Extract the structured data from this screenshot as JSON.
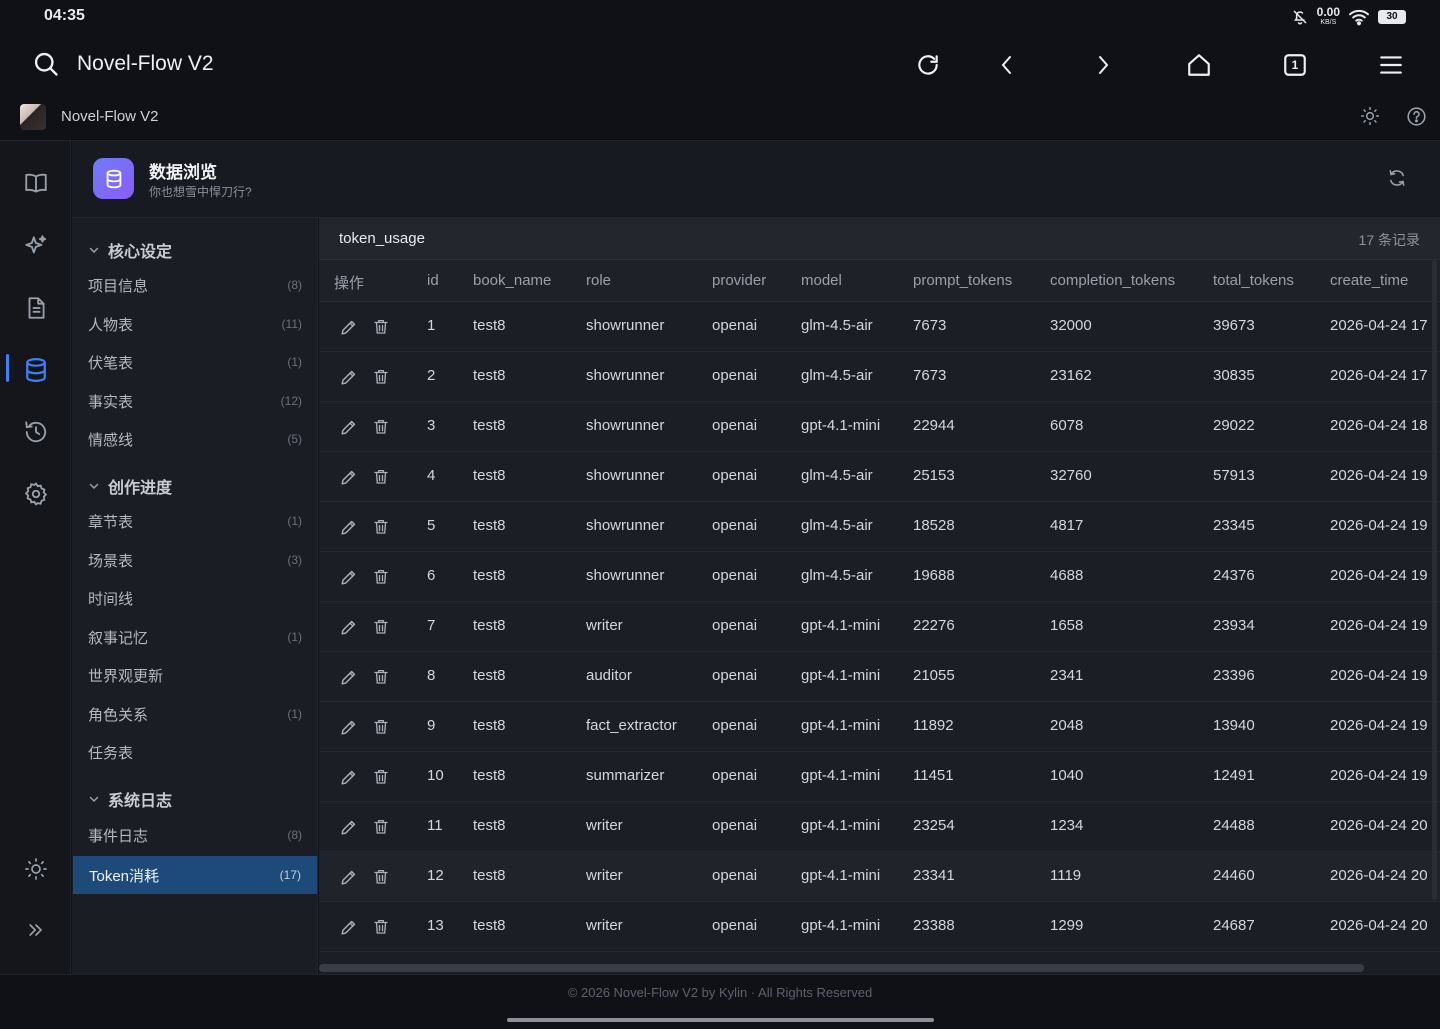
{
  "status": {
    "time": "04:35",
    "net_speed": "0.00",
    "net_unit": "KB/S",
    "battery": "30"
  },
  "browser": {
    "title": "Novel-Flow V2",
    "tab_count": "1"
  },
  "app": {
    "name": "Novel-Flow V2"
  },
  "page": {
    "title": "数据浏览",
    "subtitle": "你也想雪中悍刀行?"
  },
  "sidebar": {
    "groups": [
      {
        "label": "核心设定",
        "items": [
          {
            "label": "项目信息",
            "count": "(8)"
          },
          {
            "label": "人物表",
            "count": "(11)"
          },
          {
            "label": "伏笔表",
            "count": "(1)"
          },
          {
            "label": "事实表",
            "count": "(12)"
          },
          {
            "label": "情感线",
            "count": "(5)"
          }
        ]
      },
      {
        "label": "创作进度",
        "items": [
          {
            "label": "章节表",
            "count": "(1)"
          },
          {
            "label": "场景表",
            "count": "(3)"
          },
          {
            "label": "时间线",
            "count": ""
          },
          {
            "label": "叙事记忆",
            "count": "(1)"
          },
          {
            "label": "世界观更新",
            "count": ""
          },
          {
            "label": "角色关系",
            "count": "(1)"
          },
          {
            "label": "任务表",
            "count": ""
          }
        ]
      },
      {
        "label": "系统日志",
        "items": [
          {
            "label": "事件日志",
            "count": "(8)"
          },
          {
            "label": "Token消耗",
            "count": "(17)"
          }
        ]
      }
    ]
  },
  "table": {
    "name": "token_usage",
    "record_count": "17 条记录",
    "headers": [
      "操作",
      "id",
      "book_name",
      "role",
      "provider",
      "model",
      "prompt_tokens",
      "completion_tokens",
      "total_tokens",
      "create_time"
    ],
    "rows": [
      [
        "1",
        "test8",
        "showrunner",
        "openai",
        "glm-4.5-air",
        "7673",
        "32000",
        "39673",
        "2026-04-24 17"
      ],
      [
        "2",
        "test8",
        "showrunner",
        "openai",
        "glm-4.5-air",
        "7673",
        "23162",
        "30835",
        "2026-04-24 17"
      ],
      [
        "3",
        "test8",
        "showrunner",
        "openai",
        "gpt-4.1-mini",
        "22944",
        "6078",
        "29022",
        "2026-04-24 18"
      ],
      [
        "4",
        "test8",
        "showrunner",
        "openai",
        "glm-4.5-air",
        "25153",
        "32760",
        "57913",
        "2026-04-24 19"
      ],
      [
        "5",
        "test8",
        "showrunner",
        "openai",
        "glm-4.5-air",
        "18528",
        "4817",
        "23345",
        "2026-04-24 19"
      ],
      [
        "6",
        "test8",
        "showrunner",
        "openai",
        "glm-4.5-air",
        "19688",
        "4688",
        "24376",
        "2026-04-24 19"
      ],
      [
        "7",
        "test8",
        "writer",
        "openai",
        "gpt-4.1-mini",
        "22276",
        "1658",
        "23934",
        "2026-04-24 19"
      ],
      [
        "8",
        "test8",
        "auditor",
        "openai",
        "gpt-4.1-mini",
        "21055",
        "2341",
        "23396",
        "2026-04-24 19"
      ],
      [
        "9",
        "test8",
        "fact_extractor",
        "openai",
        "gpt-4.1-mini",
        "11892",
        "2048",
        "13940",
        "2026-04-24 19"
      ],
      [
        "10",
        "test8",
        "summarizer",
        "openai",
        "gpt-4.1-mini",
        "11451",
        "1040",
        "12491",
        "2026-04-24 19"
      ],
      [
        "11",
        "test8",
        "writer",
        "openai",
        "gpt-4.1-mini",
        "23254",
        "1234",
        "24488",
        "2026-04-24 20"
      ],
      [
        "12",
        "test8",
        "writer",
        "openai",
        "gpt-4.1-mini",
        "23341",
        "1119",
        "24460",
        "2026-04-24 20"
      ],
      [
        "13",
        "test8",
        "writer",
        "openai",
        "gpt-4.1-mini",
        "23388",
        "1299",
        "24687",
        "2026-04-24 20"
      ]
    ]
  },
  "footer": {
    "copyright": "© 2026 Novel-Flow V2 by Kylin · All Rights Reserved"
  },
  "icons": {
    "rail": [
      "book-icon",
      "sparkle-icon",
      "document-icon",
      "database-icon",
      "history-icon",
      "settings-icon"
    ],
    "rail_bottom": [
      "sun-icon",
      "expand-icon"
    ]
  },
  "colors": {
    "accent": "#3b82f6",
    "selected_row": "#1e4a7a",
    "db_icon_gradient": [
      "#6d7cf7",
      "#8b5cf6"
    ]
  }
}
